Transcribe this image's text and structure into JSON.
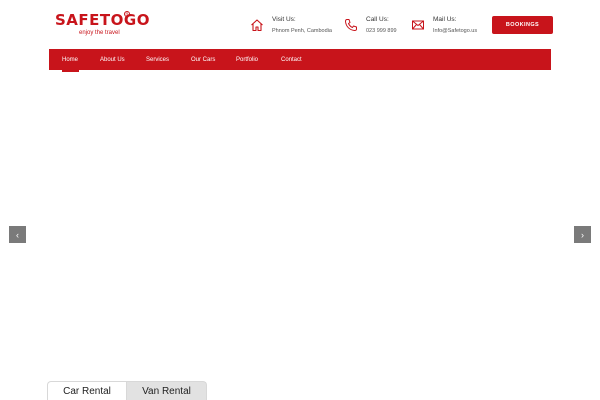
{
  "brand": {
    "name": "SAFETOGO",
    "registered_mark": "R",
    "tagline": "enjoy the travel",
    "color": "#c8141b"
  },
  "contacts": [
    {
      "icon": "house-icon",
      "label": "Visit Us:",
      "value": "Phnom Penh, Cambodia"
    },
    {
      "icon": "phone-icon",
      "label": "Call Us:",
      "value": "023 999 899"
    },
    {
      "icon": "mail-icon",
      "label": "Mail Us:",
      "value": "Info@Safetogo.us"
    }
  ],
  "bookings_button": {
    "label": "BOOKINGS"
  },
  "nav": {
    "items": [
      {
        "label": "Home",
        "active": true
      },
      {
        "label": "About Us"
      },
      {
        "label": "Services"
      },
      {
        "label": "Our Cars"
      },
      {
        "label": "Portfolio"
      },
      {
        "label": "Contact"
      }
    ]
  },
  "slider": {
    "prev_glyph": "‹",
    "next_glyph": "›"
  },
  "tabs": [
    {
      "label": "Car Rental",
      "active": true
    },
    {
      "label": "Van Rental",
      "active": false
    }
  ],
  "colors": {
    "accent": "#c8141b",
    "arrow_bg": "#7a7a7a",
    "inactive_tab_bg": "#e2e2e2"
  }
}
